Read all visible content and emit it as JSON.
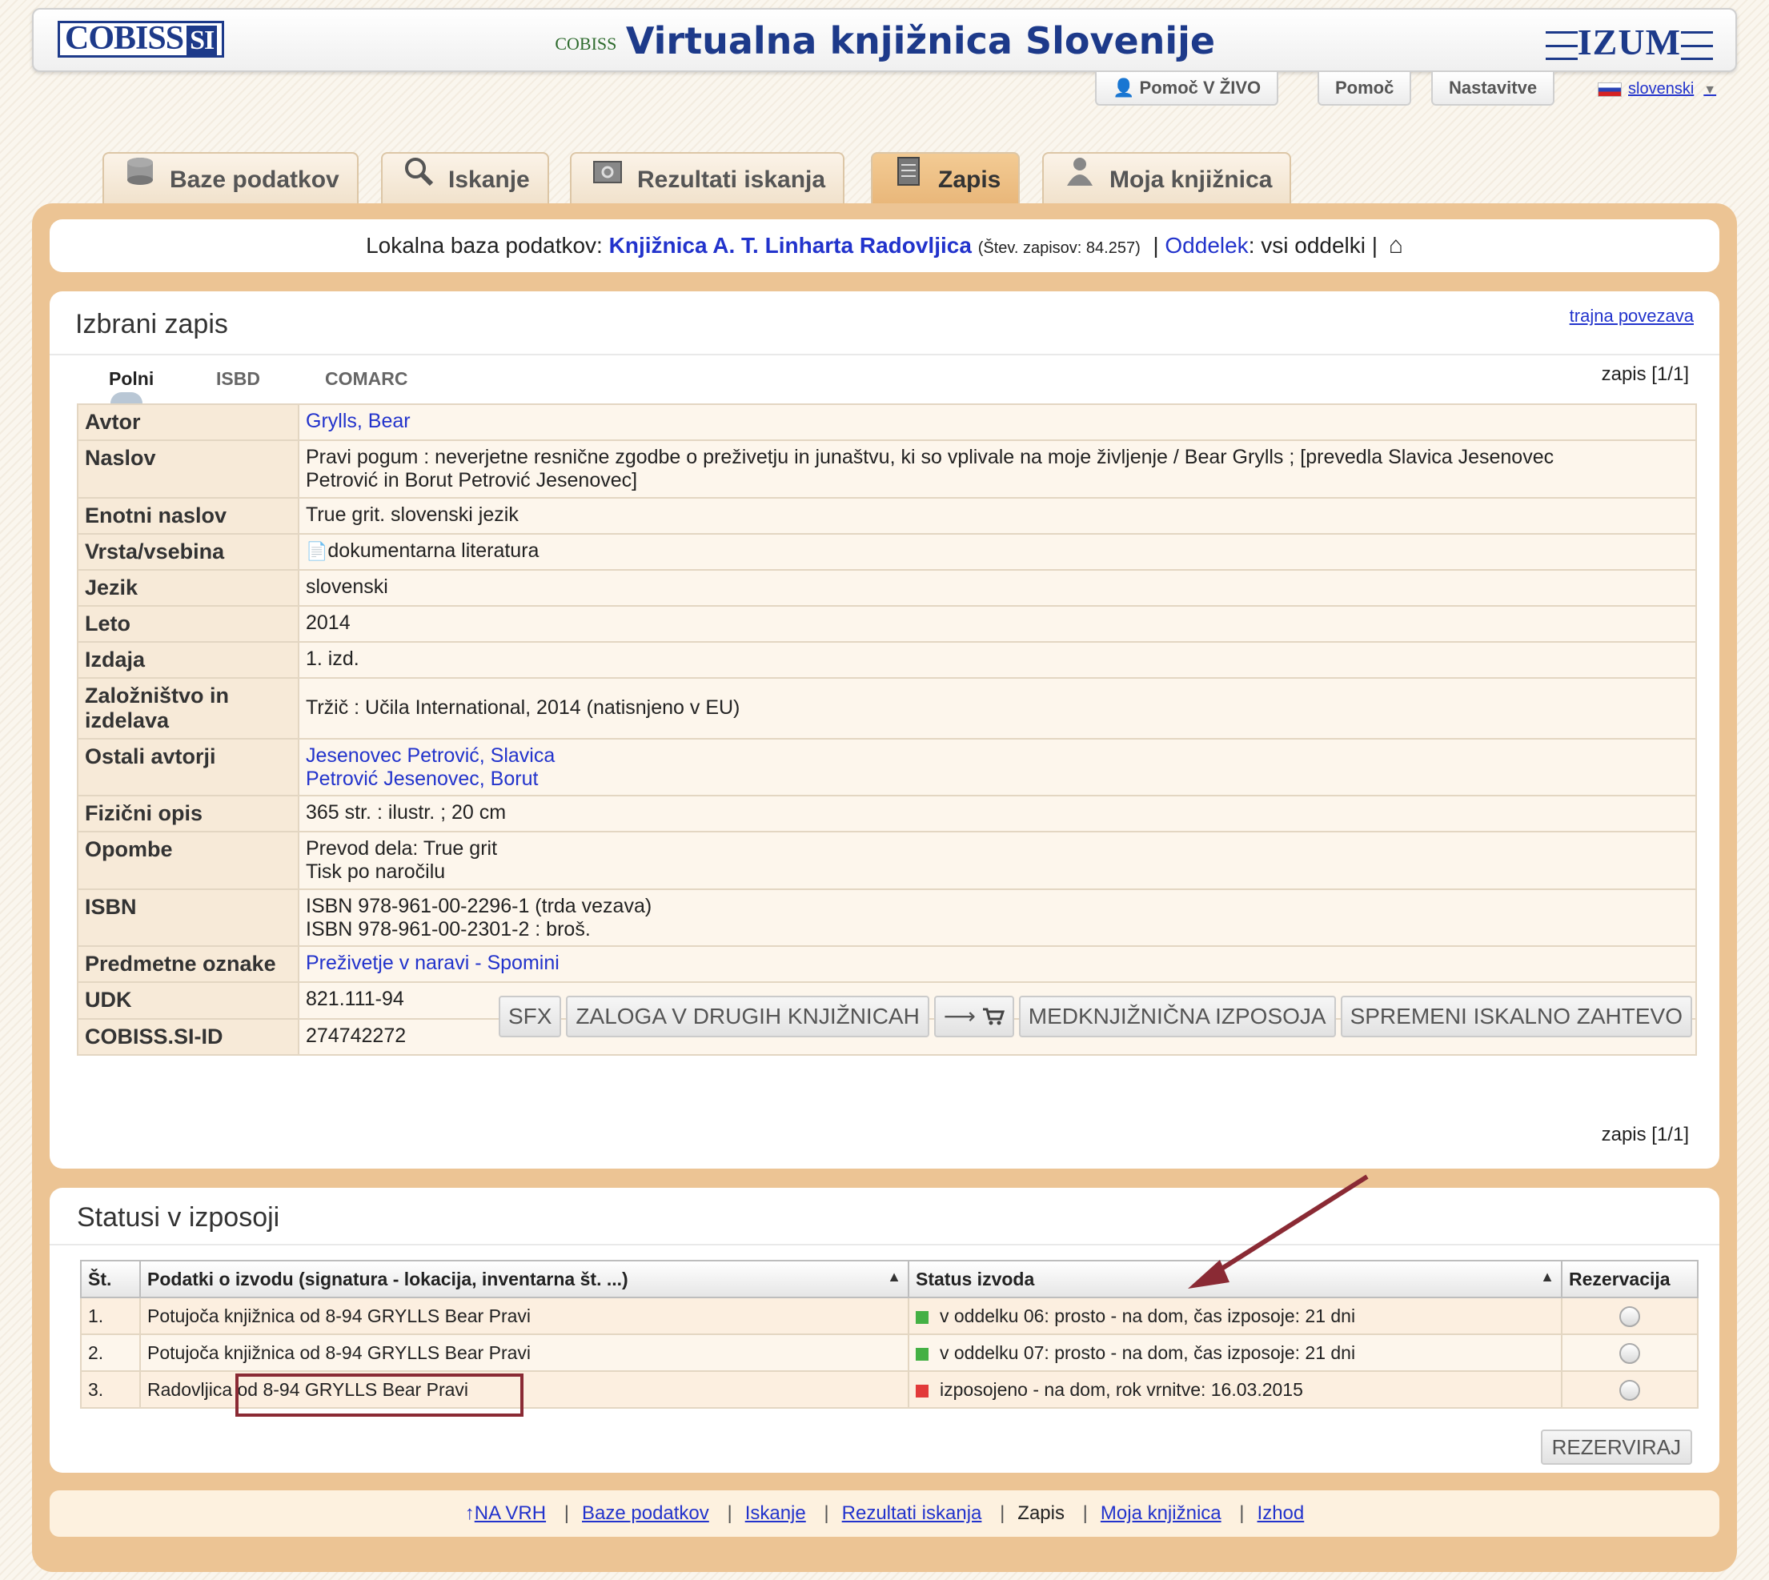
{
  "header": {
    "cobiss_logo": "COBISS",
    "cobiss_logo_suffix": "SI",
    "site_icon_text": "COBISS",
    "site_title": "Virtualna knjižnica Slovenije",
    "izum_logo": "IZUM"
  },
  "utility": {
    "live_help": "Pomoč V ŽIVO",
    "help": "Pomoč",
    "settings": "Nastavitve",
    "language": "slovenski"
  },
  "tabs": [
    {
      "label": "Baze podatkov",
      "icon": "database-icon"
    },
    {
      "label": "Iskanje",
      "icon": "magnifier-icon"
    },
    {
      "label": "Rezultati iskanja",
      "icon": "results-folder-icon"
    },
    {
      "label": "Zapis",
      "icon": "record-icon"
    },
    {
      "label": "Moja knjižnica",
      "icon": "user-icon"
    }
  ],
  "infobar": {
    "prefix": "Lokalna baza podatkov:",
    "library": "Knjižnica A. T. Linharta Radovljica",
    "count": "(Štev. zapisov: 84.257)",
    "dept_label": "Oddelek",
    "dept_value": ": vsi oddelki |"
  },
  "record": {
    "title": "Izbrani zapis",
    "permalink": "trajna povezava",
    "formats": [
      "Polni",
      "ISBD",
      "COMARC"
    ],
    "counter": "zapis [1/1]",
    "rows": [
      {
        "label": "Avtor",
        "lines": [
          "Grylls, Bear"
        ]
      },
      {
        "label": "Naslov",
        "lines": [
          "Pravi pogum : neverjetne resnične zgodbe o preživetju in junaštvu, ki so vplivale na moje življenje / Bear Grylls ; [prevedla Slavica Jesenovec",
          "Petrović in Borut Petrović Jesenovec]"
        ]
      },
      {
        "label": "Enotni naslov",
        "lines": [
          "True grit. slovenski jezik"
        ]
      },
      {
        "label": "Vrsta/vsebina",
        "lines": [
          "dokumentarna literatura"
        ]
      },
      {
        "label": "Jezik",
        "lines": [
          "slovenski"
        ]
      },
      {
        "label": "Leto",
        "lines": [
          "2014"
        ]
      },
      {
        "label": "Izdaja",
        "lines": [
          "1. izd."
        ]
      },
      {
        "label": "Založništvo in izdelava",
        "lines": [
          "Tržič : Učila International, 2014 (natisnjeno v EU)"
        ]
      },
      {
        "label": "Ostali avtorji",
        "lines": [
          "Jesenovec Petrović, Slavica",
          "Petrović Jesenovec, Borut"
        ]
      },
      {
        "label": "Fizični opis",
        "lines": [
          "365 str. : ilustr. ; 20 cm"
        ]
      },
      {
        "label": "Opombe",
        "lines": [
          "Prevod dela: True grit",
          "Tisk po naročilu"
        ]
      },
      {
        "label": "ISBN",
        "lines": [
          "ISBN 978-961-00-2296-1 (trda vezava)",
          "ISBN 978-961-00-2301-2 : broš."
        ]
      },
      {
        "label": "Predmetne oznake",
        "lines": [
          "Preživetje v naravi",
          " - ",
          "Spomini"
        ]
      },
      {
        "label": "UDK",
        "lines": [
          "821.111-94"
        ]
      },
      {
        "label": "COBISS.SI-ID",
        "lines": [
          "274742272"
        ]
      }
    ],
    "buttons": {
      "sfx": "SFX",
      "holdings": "ZALOGA V DRUGIH KNJIŽNICAH",
      "interlibrary": "MEDKNJIŽNIČNA IZPOSOJA",
      "modify": "SPREMENI ISKALNO ZAHTEVO"
    }
  },
  "loans": {
    "title": "Statusi v izposoji",
    "headers": [
      "Št.",
      "Podatki o izvodu (signatura - lokacija, inventarna št. ...)",
      "Status izvoda",
      "Rezervacija"
    ],
    "rows": [
      {
        "no": "1.",
        "copy": "Potujoča knjižnica od 8-94 GRYLLS Bear Pravi",
        "status": "v oddelku 06: prosto - na dom, čas izposoje: 21 dni",
        "status_color": "#44b044"
      },
      {
        "no": "2.",
        "copy": "Potujoča knjižnica od 8-94 GRYLLS Bear Pravi",
        "status": "v oddelku 07: prosto - na dom, čas izposoje: 21 dni",
        "status_color": "#44b044"
      },
      {
        "no": "3.",
        "copy": "Radovljica od 8-94 GRYLLS Bear Pravi",
        "status": "izposojeno - na dom, rok vrnitve: 16.03.2015",
        "status_color": "#e23a3a"
      }
    ],
    "reserve_button": "REZERVIRAJ"
  },
  "footer": {
    "items": [
      "NA VRH",
      "Baze podatkov",
      "Iskanje",
      "Rezultati iskanja",
      "Zapis",
      "Moja knjižnica",
      "Izhod"
    ],
    "current": "Zapis"
  },
  "colors": {
    "accent": "#ecc494",
    "link": "#2233cc",
    "annotation": "#8a2a34"
  }
}
